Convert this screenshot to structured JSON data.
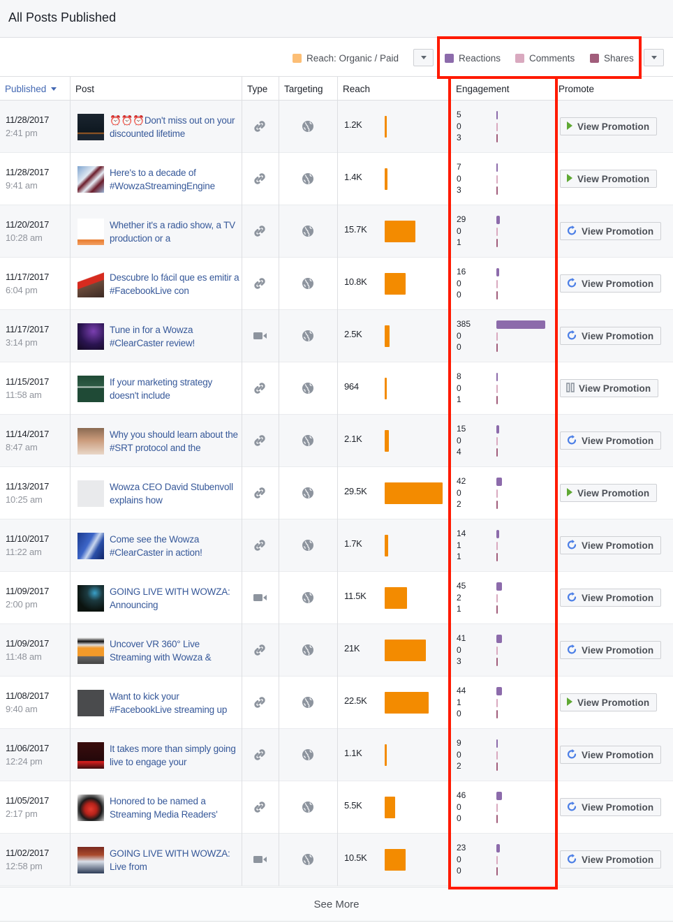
{
  "page": {
    "title": "All Posts Published",
    "see_more_label": "See More"
  },
  "legend": {
    "reach": {
      "label": "Reach: Organic / Paid",
      "color": "#fcbe75"
    },
    "reactions": {
      "label": "Reactions",
      "color": "#8c6bab"
    },
    "comments": {
      "label": "Comments",
      "color": "#d9a9bf"
    },
    "shares": {
      "label": "Shares",
      "color": "#a15d7b"
    },
    "reach_dropdown_icon": "caret-down-icon",
    "engagement_dropdown_icon": "caret-down-icon"
  },
  "colors": {
    "reach_bar": "#f38b00",
    "reactions_bar": "#8c6bab",
    "comments_bar": "#d9a9bf",
    "shares_bar": "#a15d7b",
    "annotation_red": "#ff1a00",
    "play_green": "#5fa833",
    "refresh_blue": "#4c7fe6",
    "pause_gray": "#8d949e"
  },
  "columns": {
    "published": "Published",
    "post": "Post",
    "type": "Type",
    "targeting": "Targeting",
    "reach": "Reach",
    "engagement": "Engagement",
    "promote": "Promote"
  },
  "scales": {
    "reach_max_k": 29.5,
    "engagement_max": 385
  },
  "rows": [
    {
      "date": "11/28/2017",
      "time": "2:41 pm",
      "text": "⏰⏰⏰Don't miss out on your discounted lifetime",
      "thumb": "dark-text",
      "type": "link",
      "reach_label": "1.2K",
      "reach_k": 1.2,
      "reactions": 5,
      "comments": 0,
      "shares": 3,
      "promo_status": "active",
      "promo_label": "View Promotion"
    },
    {
      "date": "11/28/2017",
      "time": "9:41 am",
      "text": "Here's to a decade of #WowzaStreamingEngine",
      "thumb": "blue-maroon",
      "type": "link",
      "reach_label": "1.4K",
      "reach_k": 1.4,
      "reactions": 7,
      "comments": 0,
      "shares": 3,
      "promo_status": "active",
      "promo_label": "View Promotion"
    },
    {
      "date": "11/20/2017",
      "time": "10:28 am",
      "text": "Whether it's a radio show, a TV production or a",
      "thumb": "white-orange",
      "type": "link",
      "reach_label": "15.7K",
      "reach_k": 15.7,
      "reactions": 29,
      "comments": 0,
      "shares": 1,
      "promo_status": "completed",
      "promo_label": "View Promotion"
    },
    {
      "date": "11/17/2017",
      "time": "6:04 pm",
      "text": "Descubre lo fácil que es emitir a #FacebookLive con",
      "thumb": "red-stripe",
      "type": "link",
      "reach_label": "10.8K",
      "reach_k": 10.8,
      "reactions": 16,
      "comments": 0,
      "shares": 0,
      "promo_status": "completed",
      "promo_label": "View Promotion"
    },
    {
      "date": "11/17/2017",
      "time": "3:14 pm",
      "text": "Tune in for a Wowza #ClearCaster review!",
      "thumb": "purple-stage",
      "type": "video",
      "reach_label": "2.5K",
      "reach_k": 2.5,
      "reactions": 385,
      "comments": 0,
      "shares": 0,
      "promo_status": "completed",
      "promo_label": "View Promotion"
    },
    {
      "date": "11/15/2017",
      "time": "11:58 am",
      "text": "If your marketing strategy doesn't include",
      "thumb": "green-text",
      "type": "link",
      "reach_label": "964",
      "reach_k": 0.964,
      "reactions": 8,
      "comments": 0,
      "shares": 1,
      "promo_status": "paused",
      "promo_label": "View Promotion"
    },
    {
      "date": "11/14/2017",
      "time": "8:47 am",
      "text": "Why you should learn about the #SRT protocol and the",
      "thumb": "face",
      "type": "link",
      "reach_label": "2.1K",
      "reach_k": 2.1,
      "reactions": 15,
      "comments": 0,
      "shares": 4,
      "promo_status": "completed",
      "promo_label": "View Promotion"
    },
    {
      "date": "11/13/2017",
      "time": "10:25 am",
      "text": "Wowza CEO David Stubenvoll explains how",
      "thumb": "blank",
      "type": "link",
      "reach_label": "29.5K",
      "reach_k": 29.5,
      "reactions": 42,
      "comments": 0,
      "shares": 2,
      "promo_status": "active",
      "promo_label": "View Promotion"
    },
    {
      "date": "11/10/2017",
      "time": "11:22 am",
      "text": "Come see the Wowza #ClearCaster in action!",
      "thumb": "blue-banner",
      "type": "link",
      "reach_label": "1.7K",
      "reach_k": 1.7,
      "reactions": 14,
      "comments": 1,
      "shares": 1,
      "promo_status": "completed",
      "promo_label": "View Promotion"
    },
    {
      "date": "11/09/2017",
      "time": "2:00 pm",
      "text": "GOING LIVE WITH WOWZA: Announcing",
      "thumb": "dark-screen",
      "type": "video",
      "reach_label": "11.5K",
      "reach_k": 11.5,
      "reactions": 45,
      "comments": 2,
      "shares": 1,
      "promo_status": "completed",
      "promo_label": "View Promotion"
    },
    {
      "date": "11/09/2017",
      "time": "11:48 am",
      "text": "Uncover VR 360° Live Streaming with Wowza &",
      "thumb": "orange-ui",
      "type": "link",
      "reach_label": "21K",
      "reach_k": 21,
      "reactions": 41,
      "comments": 0,
      "shares": 3,
      "promo_status": "completed",
      "promo_label": "View Promotion"
    },
    {
      "date": "11/08/2017",
      "time": "9:40 am",
      "text": "Want to kick your #FacebookLive streaming up",
      "thumb": "gray",
      "type": "link",
      "reach_label": "22.5K",
      "reach_k": 22.5,
      "reactions": 44,
      "comments": 1,
      "shares": 0,
      "promo_status": "active",
      "promo_label": "View Promotion"
    },
    {
      "date": "11/06/2017",
      "time": "12:24 pm",
      "text": "It takes more than simply going live to engage your",
      "thumb": "dark-red",
      "type": "link",
      "reach_label": "1.1K",
      "reach_k": 1.1,
      "reactions": 9,
      "comments": 0,
      "shares": 2,
      "promo_status": "completed",
      "promo_label": "View Promotion"
    },
    {
      "date": "11/05/2017",
      "time": "2:17 pm",
      "text": "Honored to be named a Streaming Media Readers'",
      "thumb": "red-logo",
      "type": "link",
      "reach_label": "5.5K",
      "reach_k": 5.5,
      "reactions": 46,
      "comments": 0,
      "shares": 0,
      "promo_status": "completed",
      "promo_label": "View Promotion"
    },
    {
      "date": "11/02/2017",
      "time": "12:58 pm",
      "text": "GOING LIVE WITH WOWZA: Live from",
      "thumb": "person",
      "type": "video",
      "reach_label": "10.5K",
      "reach_k": 10.5,
      "reactions": 23,
      "comments": 0,
      "shares": 0,
      "promo_status": "completed",
      "promo_label": "View Promotion"
    }
  ]
}
